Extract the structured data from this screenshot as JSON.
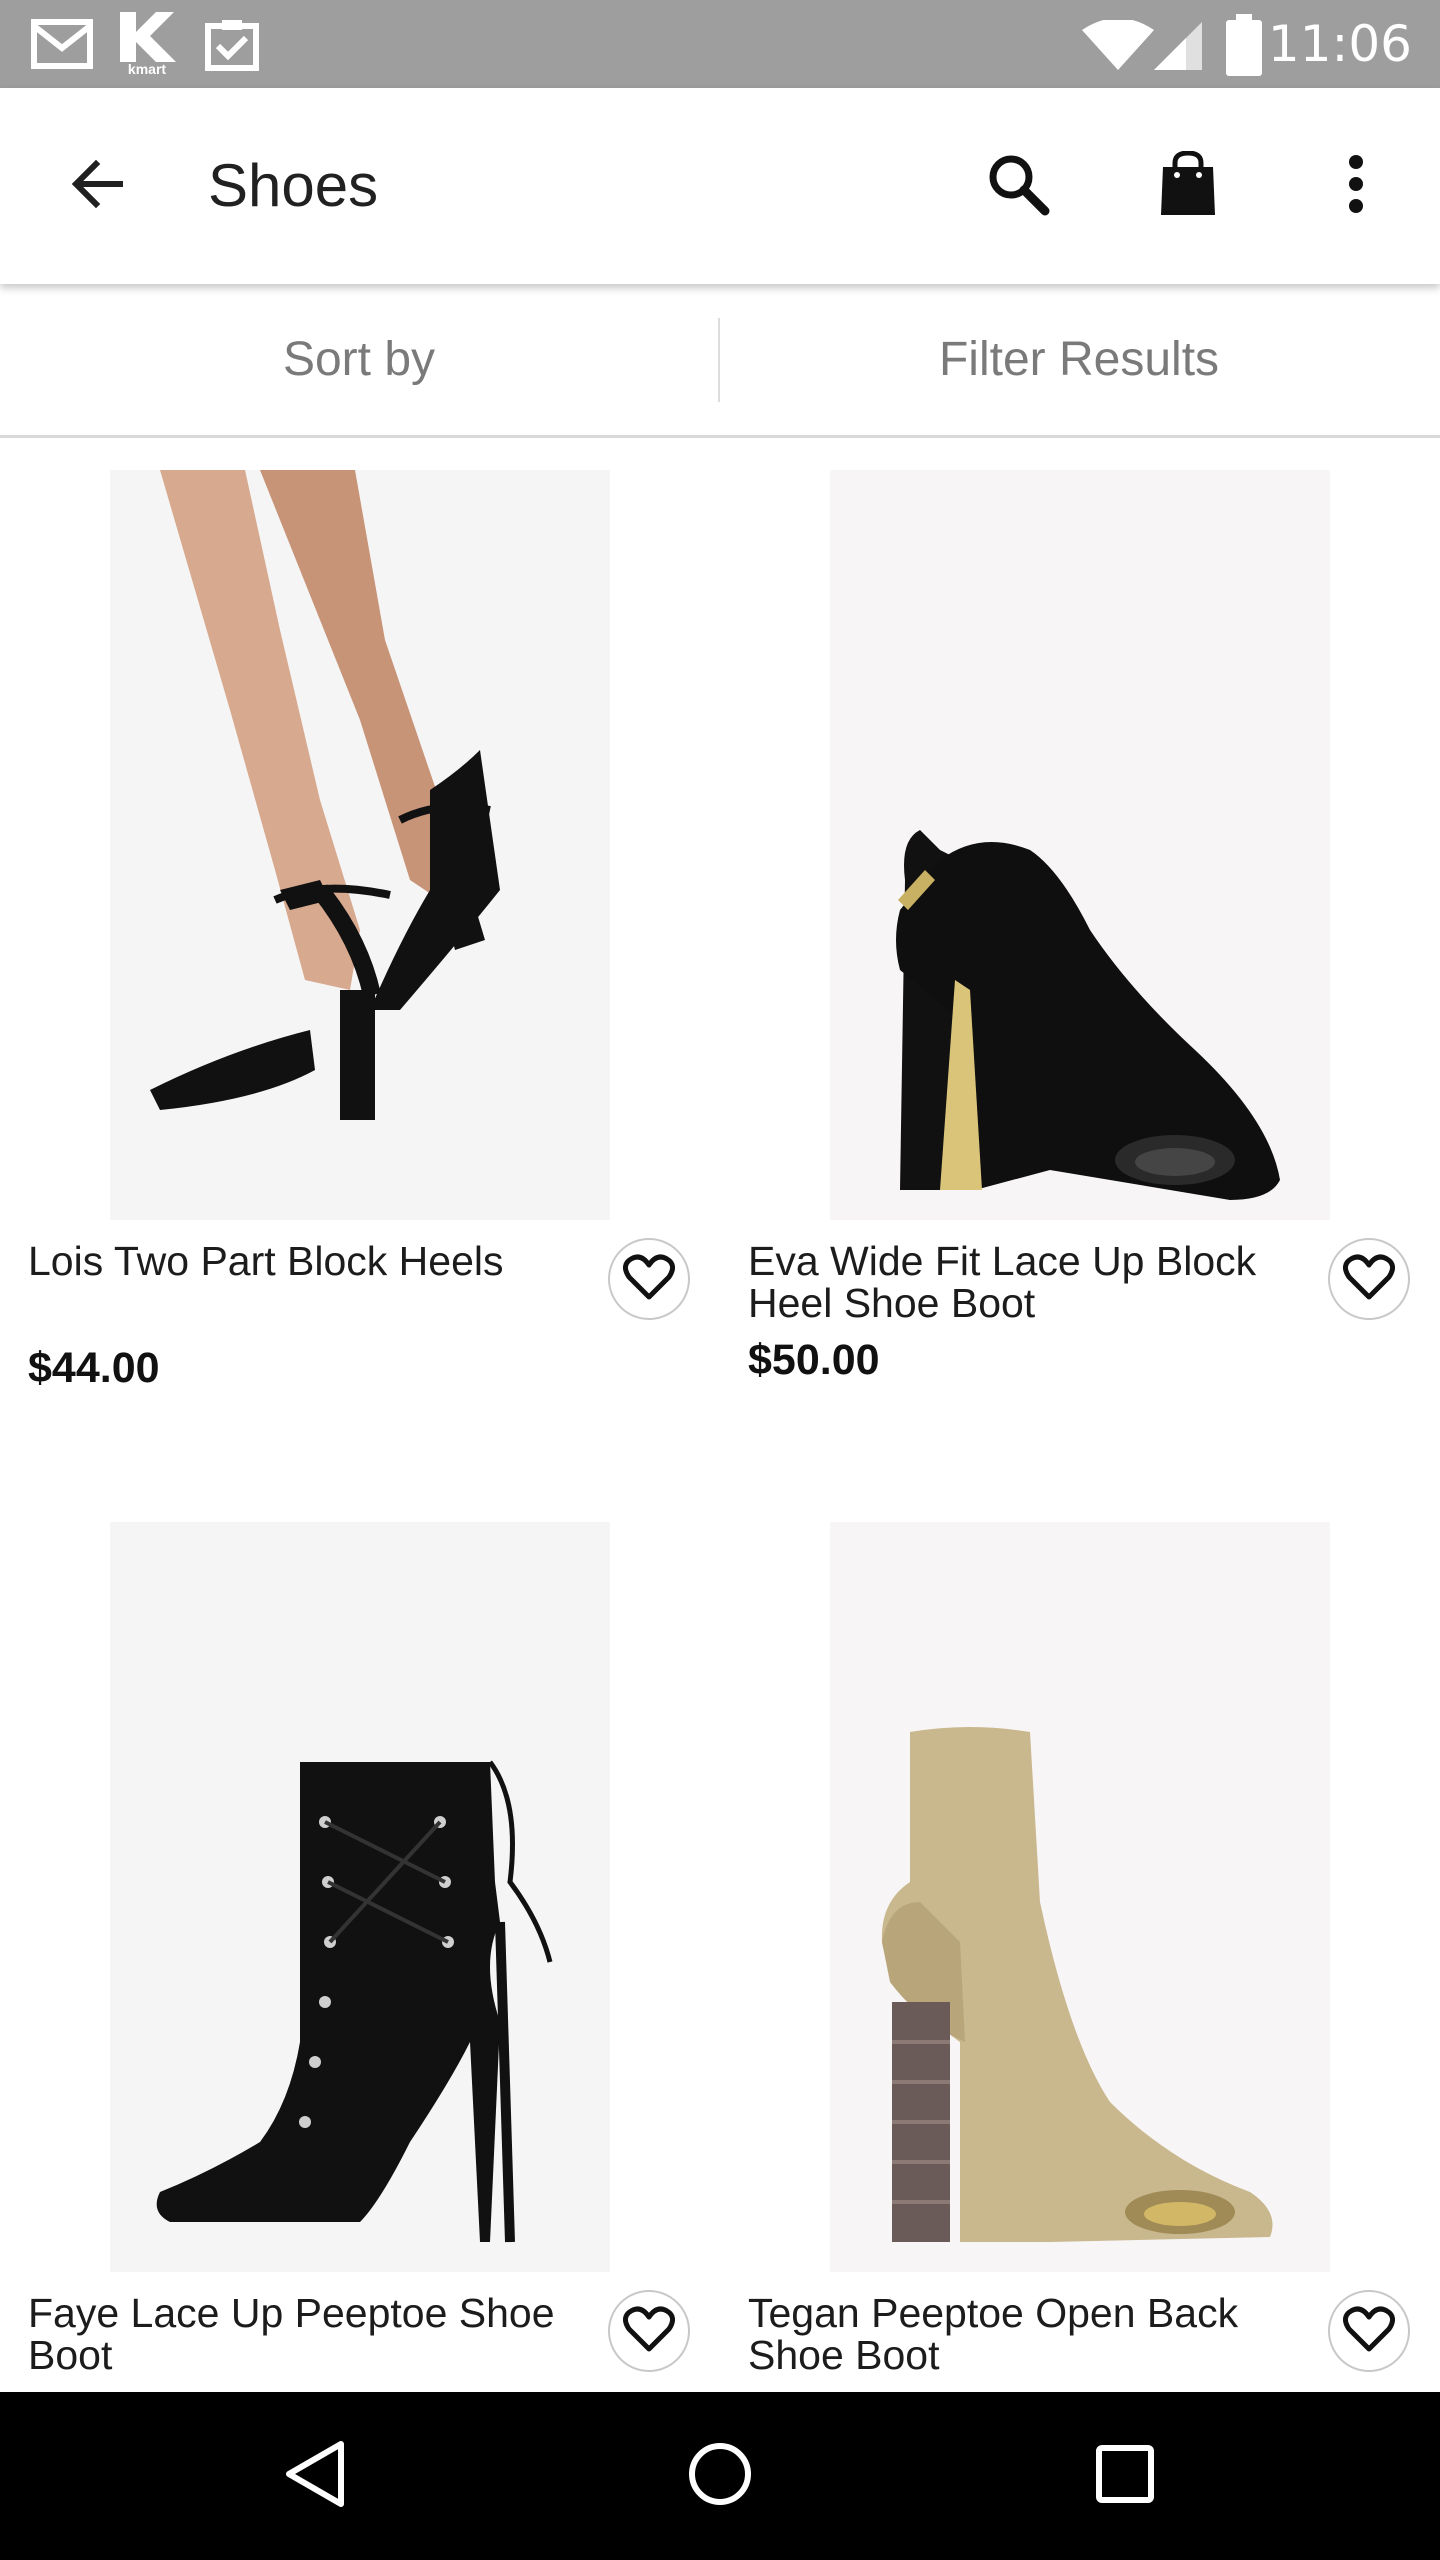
{
  "status_bar": {
    "time": "11:06",
    "icons": [
      "gmail-icon",
      "kmart-app-icon",
      "clipboard-check-icon",
      "wifi-icon",
      "cell-signal-icon",
      "battery-icon"
    ],
    "kmart_label": "kmart"
  },
  "app_bar": {
    "title": "Shoes",
    "back_icon": "arrow-back-icon",
    "search_icon": "search-icon",
    "cart_icon": "shopping-bag-icon",
    "menu_icon": "more-vert-icon"
  },
  "sort_filter": {
    "sort_label": "Sort by",
    "filter_label": "Filter Results"
  },
  "products": [
    {
      "name": "Lois Two Part Block Heels",
      "price": "$44.00",
      "image": "black-block-heel-sandal"
    },
    {
      "name": "Eva Wide Fit Lace Up Block Heel Shoe Boot",
      "price": "$50.00",
      "image": "black-peeptoe-shoe-boot"
    },
    {
      "name": "Faye Lace Up Peeptoe Shoe Boot",
      "price": "",
      "image": "black-lace-up-stiletto-boot"
    },
    {
      "name": "Tegan Peeptoe Open Back Shoe Boot",
      "price": "",
      "image": "tan-peeptoe-sock-boot"
    }
  ],
  "nav_bar": {
    "back": "nav-back-icon",
    "home": "nav-home-icon",
    "recents": "nav-recents-icon"
  },
  "colors": {
    "status_bar": "#9e9e9e",
    "accent_text": "#212121",
    "nav_bar": "#000000"
  }
}
